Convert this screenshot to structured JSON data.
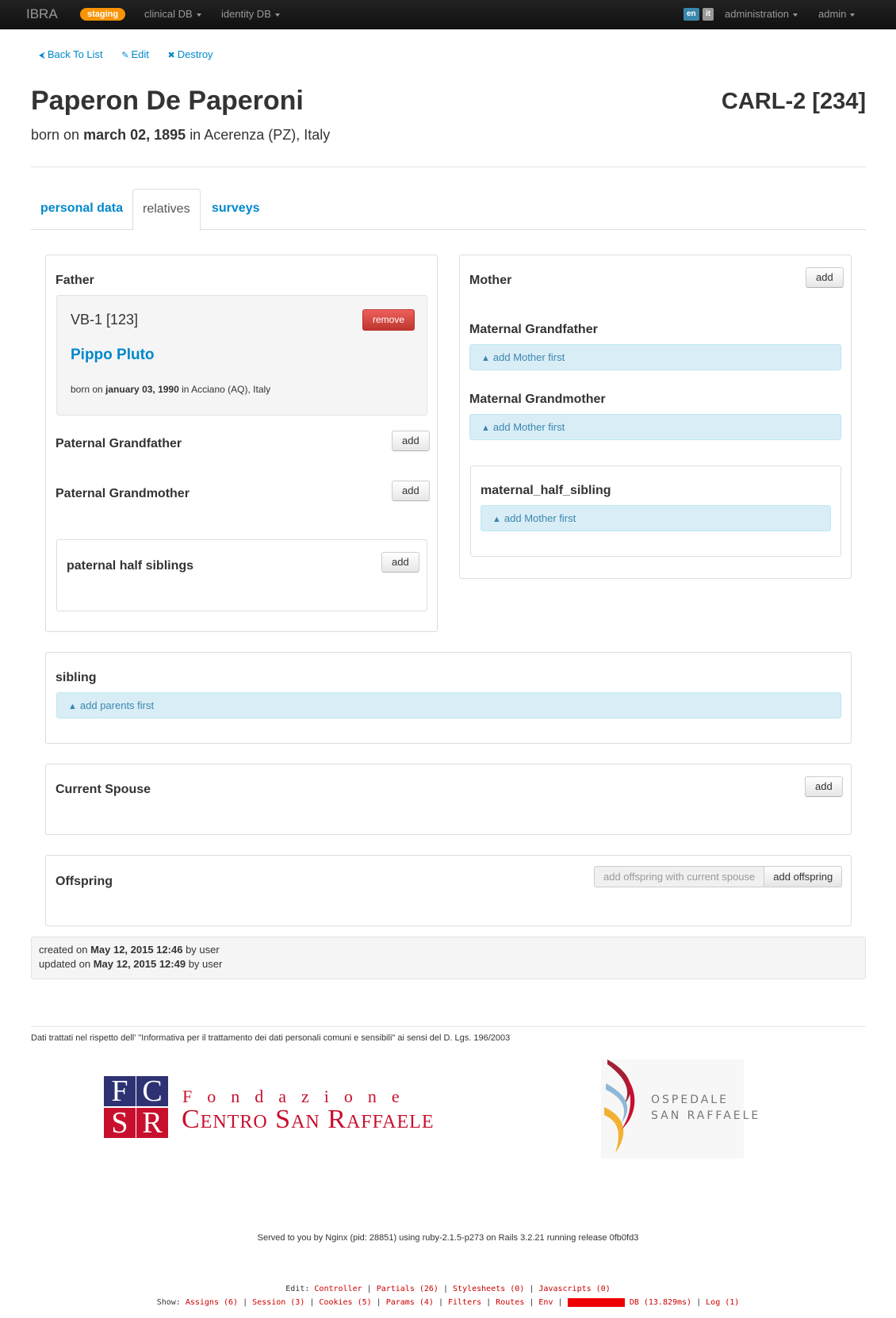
{
  "navbar": {
    "brand": "IBRA",
    "env_badge": "staging",
    "menu_clinical": "clinical DB",
    "menu_identity": "identity DB",
    "lang_en": "en",
    "lang_it": "it",
    "menu_admin": "administration",
    "menu_user": "admin",
    "colors": {
      "background": "#1b1b1b",
      "badge": "#f89406",
      "lang_en": "#3a87ad",
      "lang_it": "#999999"
    }
  },
  "actions": {
    "back": "Back To List",
    "edit": "Edit",
    "destroy": "Destroy"
  },
  "person": {
    "name": "Paperon De Paperoni",
    "code": "CARL-2 [234]",
    "born_prefix": "born on",
    "born_date": "march 02, 1895",
    "born_in": "in",
    "born_place": "Acerenza (PZ), Italy"
  },
  "tabs": [
    "personal data",
    "relatives",
    "surveys"
  ],
  "father": {
    "title": "Father",
    "code": "VB-1 [123]",
    "remove_label": "remove",
    "name": "Pippo Pluto",
    "born_prefix": "born on",
    "born_date": "january 03, 1990",
    "born_in": "in",
    "born_place": "Acciano (AQ), Italy"
  },
  "paternal": {
    "grandfather_title": "Paternal Grandfather",
    "grandmother_title": "Paternal Grandmother",
    "half_siblings_title": "paternal half siblings",
    "add_label": "add"
  },
  "mother": {
    "title": "Mother",
    "add_label": "add",
    "grandfather_title": "Maternal Grandfather",
    "grandmother_title": "Maternal Grandmother",
    "half_sibling_title": "maternal_half_sibling",
    "notice": "add Mother first"
  },
  "sibling": {
    "title": "sibling",
    "notice": "add parents first"
  },
  "spouse": {
    "title": "Current Spouse",
    "add_label": "add"
  },
  "offspring": {
    "title": "Offspring",
    "add_with_spouse": "add offspring with current spouse",
    "add": "add offspring"
  },
  "audit": {
    "created_prefix": "created on",
    "created_at": "May 12, 2015 12:46",
    "created_by": "by user",
    "updated_prefix": "updated on",
    "updated_at": "May 12, 2015 12:49",
    "updated_by": "by user"
  },
  "footer": {
    "privacy": "Dati trattati nel rispetto dell' \"Informativa per il trattamento dei dati personali comuni e sensibili\" ai sensi del D. Lgs. 196/2003",
    "logo_fcsr_letters": [
      "F",
      "C",
      "S",
      "R"
    ],
    "logo_fcsr_line1": "Fondazione",
    "logo_fcsr_line2": "Centro San Raffaele",
    "logo_osr_line1": "OSPEDALE",
    "logo_osr_line2": "SAN RAFFAELE",
    "served": "Served to you by Nginx (pid: 28851) using ruby-2.1.5-p273 on Rails 3.2.21 running release 0fb0fd3",
    "edit_label": "Edit:",
    "edit_links": [
      "Controller",
      "Partials (26)",
      "Stylesheets (0)",
      "Javascripts (0)"
    ],
    "show_label": "Show:",
    "show_links": [
      "Assigns (6)",
      "Session (3)",
      "Cookies (5)",
      "Params (4)",
      "Filters",
      "Routes",
      "Env",
      "Queries (13)",
      "DB (13.829ms)",
      "Log (1)"
    ]
  }
}
